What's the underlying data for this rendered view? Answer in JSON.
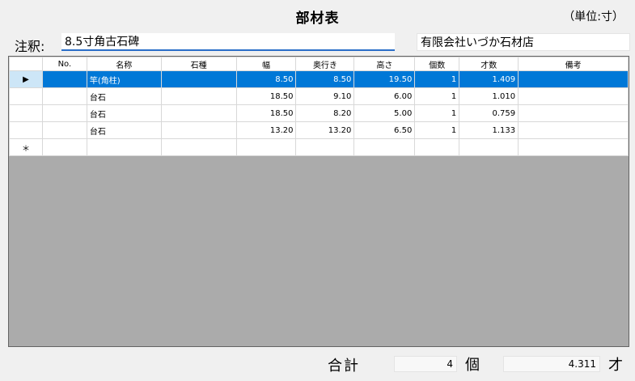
{
  "header": {
    "title": "部材表",
    "unit": "（単位:寸）"
  },
  "note": {
    "label": "注釈:",
    "value": "8.5寸角古石碑"
  },
  "company": {
    "value": "有限会社いづか石材店"
  },
  "table": {
    "columns": [
      "",
      "No.",
      "名称",
      "石種",
      "幅",
      "奥行き",
      "高さ",
      "個数",
      "才数",
      "備考"
    ],
    "rows": [
      {
        "marker": "▶",
        "no": "",
        "name": "竿(角柱)",
        "stone": "",
        "width": "8.50",
        "depth": "8.50",
        "height": "19.50",
        "count": "1",
        "sai": "1.409",
        "note": ""
      },
      {
        "marker": "",
        "no": "",
        "name": "台石",
        "stone": "",
        "width": "18.50",
        "depth": "9.10",
        "height": "6.00",
        "count": "1",
        "sai": "1.010",
        "note": ""
      },
      {
        "marker": "",
        "no": "",
        "name": "台石",
        "stone": "",
        "width": "18.50",
        "depth": "8.20",
        "height": "5.00",
        "count": "1",
        "sai": "0.759",
        "note": ""
      },
      {
        "marker": "",
        "no": "",
        "name": "台石",
        "stone": "",
        "width": "13.20",
        "depth": "13.20",
        "height": "6.50",
        "count": "1",
        "sai": "1.133",
        "note": ""
      }
    ],
    "new_row_marker": "＊",
    "selected_color": "#0078d7"
  },
  "footer": {
    "total_label": "合計",
    "total_count": "4",
    "count_unit": "個",
    "total_sai": "4.311",
    "sai_unit": "才"
  }
}
